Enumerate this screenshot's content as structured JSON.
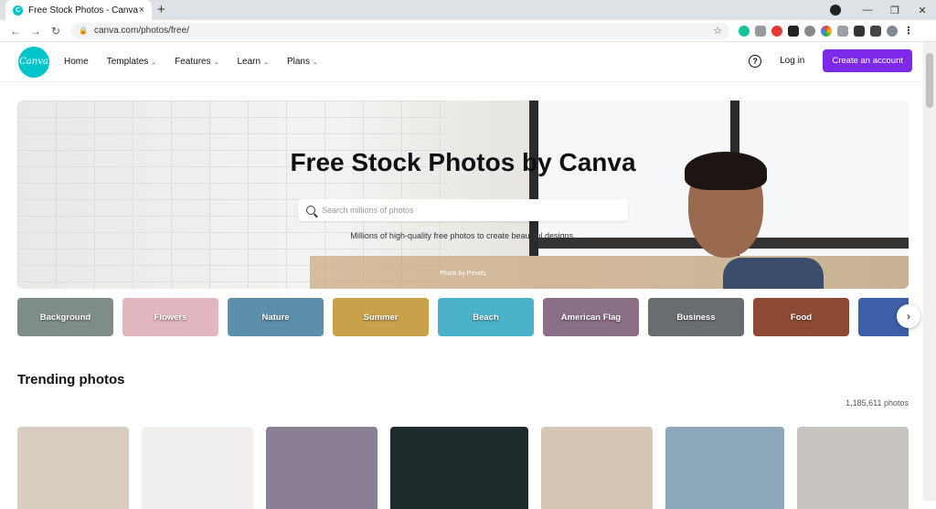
{
  "browser": {
    "tab_title": "Free Stock Photos - Canva",
    "tab_close": "×",
    "new_tab": "+",
    "url": "canva.com/photos/free/",
    "window_controls": [
      "—",
      "❐",
      "✕"
    ]
  },
  "nav": {
    "logo_text": "Canva",
    "menu": [
      {
        "label": "Home",
        "has_caret": false
      },
      {
        "label": "Templates",
        "has_caret": true
      },
      {
        "label": "Features",
        "has_caret": true
      },
      {
        "label": "Learn",
        "has_caret": true
      },
      {
        "label": "Plans",
        "has_caret": true
      }
    ],
    "help": "?",
    "login": "Log in",
    "create_account": "Create an account"
  },
  "hero": {
    "title": "Free Stock Photos by Canva",
    "search_placeholder": "Search millions of photos",
    "subtitle": "Millions of high-quality free photos to create beautiful designs.",
    "credit": "Photo by Pexels"
  },
  "categories": [
    {
      "label": "Background",
      "color": "#7f8d8a"
    },
    {
      "label": "Flowers",
      "color": "#e3b7bf"
    },
    {
      "label": "Nature",
      "color": "#5b8faa"
    },
    {
      "label": "Summer",
      "color": "#c9a14a"
    },
    {
      "label": "Beach",
      "color": "#4bb2c9"
    },
    {
      "label": "American Flag",
      "color": "#8a6f86"
    },
    {
      "label": "Business",
      "color": "#6a6d70"
    },
    {
      "label": "Food",
      "color": "#8c4a35"
    },
    {
      "label": "",
      "color": "#3d5fa8"
    }
  ],
  "trending": {
    "title": "Trending photos",
    "count": "1,185,611 photos",
    "photos": [
      {
        "color": "#d8ccc0",
        "w": 122
      },
      {
        "color": "#f0efee",
        "w": 122
      },
      {
        "color": "#8b7f93",
        "w": 122
      },
      {
        "color": "#1e2a2c",
        "w": 152
      },
      {
        "color": "#d5c6b6",
        "w": 122
      },
      {
        "color": "#8ca6ba",
        "w": 130
      },
      {
        "color": "#c8c4c2",
        "w": 122
      }
    ]
  },
  "colors": {
    "brand": "#00c4cc",
    "accent": "#7d2ae8"
  }
}
